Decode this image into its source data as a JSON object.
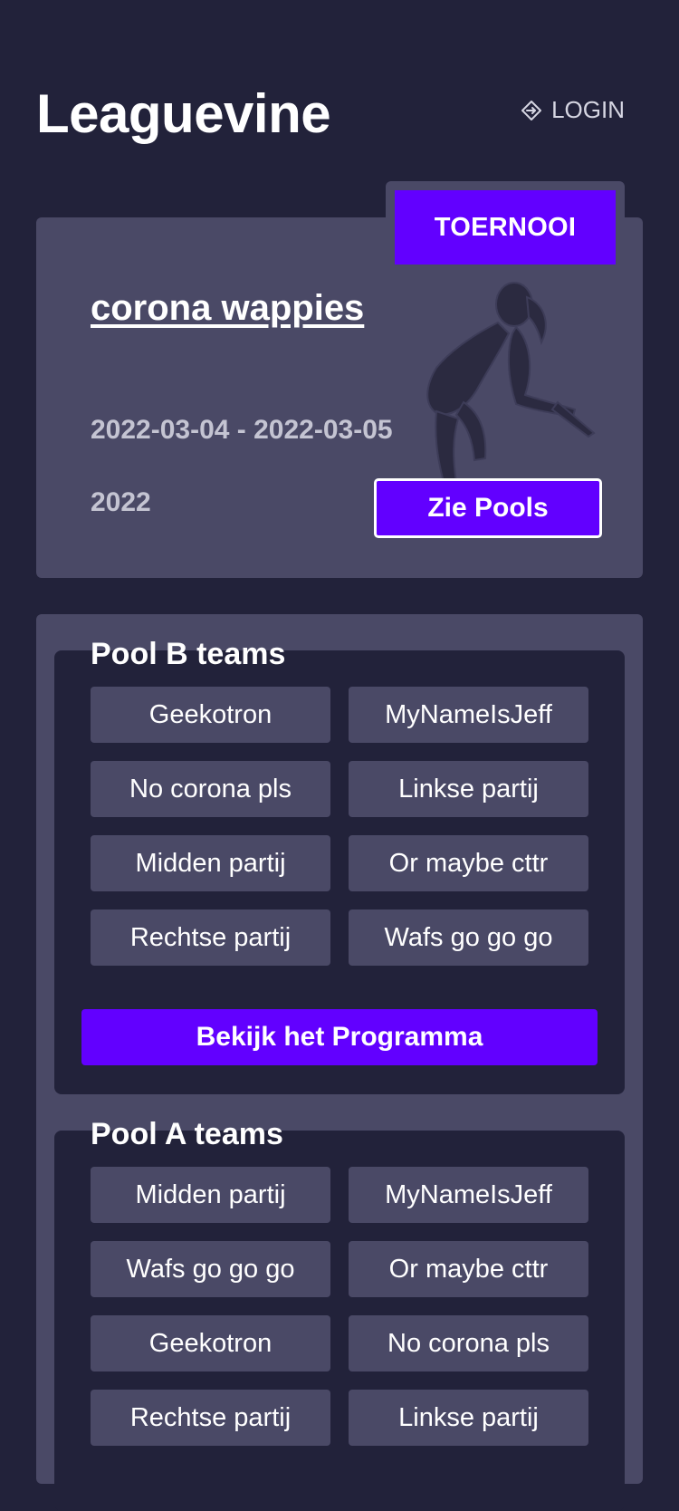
{
  "app": {
    "brand": "Leaguevine",
    "login_label": "LOGIN"
  },
  "tournament": {
    "tag": "TOERNOOI",
    "title": "corona wappies",
    "dates": "2022-03-04 - 2022-03-05",
    "year": "2022",
    "pools_button": "Zie Pools"
  },
  "pools": [
    {
      "heading": "Pool B teams",
      "teams": [
        "Geekotron",
        "MyNameIsJeff",
        "No corona pls",
        "Linkse partij",
        "Midden partij",
        "Or maybe cttr",
        "Rechtse partij",
        "Wafs go go go"
      ],
      "button": "Bekijk het Programma"
    },
    {
      "heading": "Pool A teams",
      "teams": [
        "Midden partij",
        "MyNameIsJeff",
        "Wafs go go go",
        "Or maybe cttr",
        "Geekotron",
        "No corona pls",
        "Rechtse partij",
        "Linkse partij"
      ]
    }
  ],
  "colors": {
    "background": "#22223a",
    "card": "#4a4966",
    "accent": "#6200ff"
  },
  "icons": {
    "login": "login-arrow-icon",
    "illustration": "ultimate-player-silhouette"
  }
}
